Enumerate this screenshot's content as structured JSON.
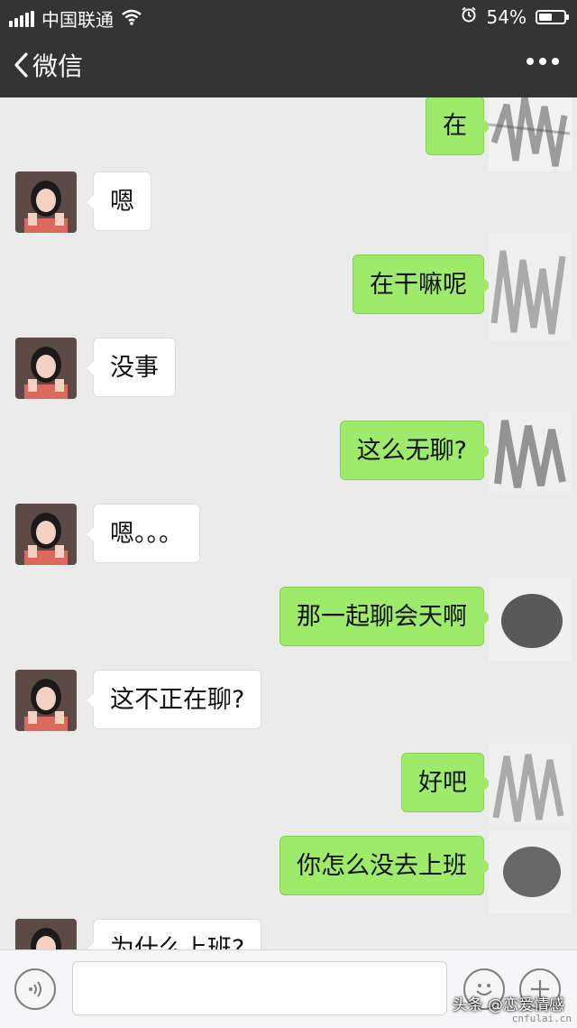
{
  "status_bar": {
    "carrier": "中国联通",
    "battery_percent": "54%",
    "battery_level": 0.54
  },
  "nav": {
    "back_label": "微信",
    "more_icon": "more-dots-icon"
  },
  "messages": [
    {
      "side": "out",
      "text": "在"
    },
    {
      "side": "in",
      "text": "嗯"
    },
    {
      "side": "out",
      "text": "在干嘛呢"
    },
    {
      "side": "in",
      "text": "没事"
    },
    {
      "side": "out",
      "text": "这么无聊?"
    },
    {
      "side": "in",
      "text": "嗯。。。"
    },
    {
      "side": "out",
      "text": "那一起聊会天啊"
    },
    {
      "side": "in",
      "text": "这不正在聊?"
    },
    {
      "side": "out",
      "text": "好吧"
    },
    {
      "side": "out",
      "text": "你怎么没去上班"
    },
    {
      "side": "in",
      "text": "为什么上班?"
    }
  ],
  "input_bar": {
    "voice_icon": "voice-icon",
    "emoji_icon": "emoji-icon",
    "add_icon": "plus-icon",
    "input_value": ""
  },
  "watermark": {
    "text": "头条 @恋爱情感",
    "site": "cnfulai.cn"
  },
  "colors": {
    "header_bg": "#343434",
    "chat_bg": "#ebebeb",
    "outgoing_bubble": "#9eea6a",
    "incoming_bubble": "#ffffff"
  }
}
